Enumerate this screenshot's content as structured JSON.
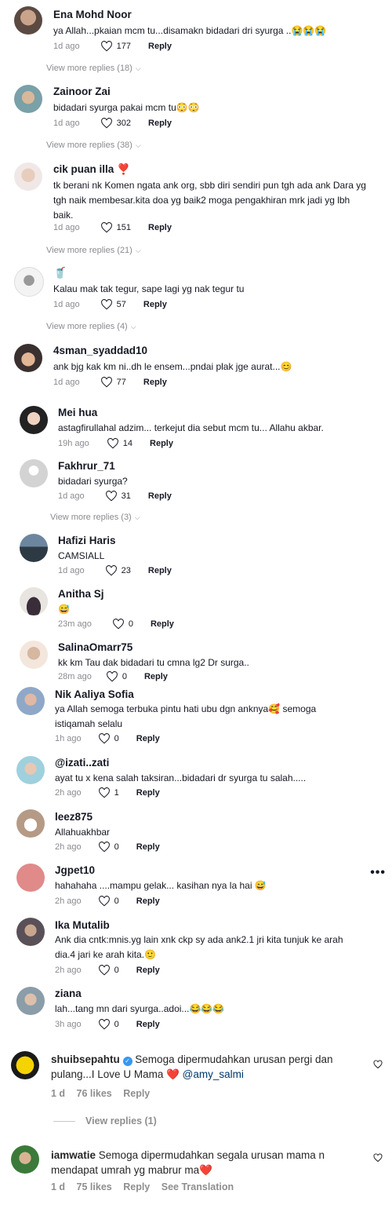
{
  "comments": [
    {
      "name": "Ena Mohd Noor",
      "text": "ya Allah...pkaian mcm tu...disamakn bidadari dri syurga ..",
      "emoji": "😭😭😭",
      "time": "1d ago",
      "likes": "177",
      "reply": "Reply",
      "view_more": "View more replies (18)"
    },
    {
      "name": "Zainoor Zai",
      "text": "bidadari syurga pakai mcm tu",
      "emoji": "😳😳",
      "time": "1d ago",
      "likes": "302",
      "reply": "Reply",
      "view_more": "View more replies (38)"
    },
    {
      "name": "cik puan illa",
      "name_emoji": "❣️",
      "text": "tk berani nk Komen ngata ank org, sbb diri sendiri pun tgh ada ank Dara yg tgh naik membesar.kita doa yg baik2 moga pengakhiran mrk jadi yg lbh baik.",
      "time": "1d ago",
      "likes": "151",
      "reply": "Reply",
      "view_more": "View more replies (21)"
    },
    {
      "name": "🥤",
      "text": "Kalau mak tak tegur, sape lagi yg nak tegur tu",
      "time": "1d ago",
      "likes": "57",
      "reply": "Reply",
      "view_more": "View more replies (4)"
    },
    {
      "name": "4sman_syaddad10",
      "text": "ank bjg kak km ni..dh le ensem...pndai plak jge aurat...",
      "emoji": "😊",
      "time": "1d ago",
      "likes": "77",
      "reply": "Reply"
    }
  ],
  "replies": [
    {
      "name": "Mei hua",
      "text": "astagfirullahal adzim... terkejut dia sebut mcm tu... Allahu akbar.",
      "time": "19h ago",
      "likes": "14",
      "reply": "Reply"
    },
    {
      "name": "Fakhrur_71",
      "text": "bidadari syurga?",
      "time": "1d ago",
      "likes": "31",
      "reply": "Reply",
      "view_more": "View more replies (3)"
    }
  ],
  "comments2": [
    {
      "name": "Hafizi Haris",
      "text": "CAMSIALL",
      "time": "1d ago",
      "likes": "23",
      "reply": "Reply"
    },
    {
      "name": "Anitha Sj",
      "text": "",
      "emoji": "😅",
      "time": "23m ago",
      "likes": "0",
      "reply": "Reply"
    },
    {
      "name": "SalinaOmarr75",
      "text": "kk km Tau dak bidadari tu cmna lg2 Dr surga..",
      "time": "28m ago",
      "likes": "0",
      "reply": "Reply"
    },
    {
      "name": "Nik Aaliya Sofia",
      "text": "ya Allah semoga terbuka pintu hati ubu dgn anknya",
      "emoji": "🥰",
      "text2": " semoga istiqamah selalu",
      "time": "1h ago",
      "likes": "0",
      "reply": "Reply"
    },
    {
      "name": "@izati..zati",
      "text": "ayat tu x kena salah taksiran...bidadari dr syurga tu salah.....",
      "time": "2h ago",
      "likes": "1",
      "reply": "Reply"
    },
    {
      "name": "leez875",
      "text": "Allahuakhbar",
      "time": "2h ago",
      "likes": "0",
      "reply": "Reply"
    },
    {
      "name": "Jgpet10",
      "text": "hahahaha ....mampu gelak... kasihan nya la hai",
      "emoji": "😅",
      "time": "2h ago",
      "likes": "0",
      "reply": "Reply"
    },
    {
      "name": "Ika Mutalib",
      "text": "Ank dia cntk:mnis.yg lain xnk ckp sy ada ank2.1 jri kita tunjuk ke arah dia.4 jari ke arah kita.",
      "emoji": "🙂",
      "time": "2h ago",
      "likes": "0",
      "reply": "Reply"
    },
    {
      "name": "ziana",
      "text": "lah...tang mn dari syurga..adoi...",
      "emoji": "😂😂😂",
      "time": "3h ago",
      "likes": "0",
      "reply": "Reply"
    }
  ],
  "more_icon": "•••",
  "ig": [
    {
      "name": "shuibsepahtu",
      "text": "Semoga dipermudahkan urusan pergi dan pulang...I Love U Mama",
      "heart": "❤️",
      "mention": "@amy_salmi",
      "time": "1 d",
      "likes": "76 likes",
      "reply": "Reply",
      "view_replies": "View replies (1)"
    },
    {
      "name": "iamwatie",
      "text": "Semoga dipermudahkan segala urusan mama n mendapat umrah yg mabrur ma",
      "heart": "❤️",
      "time": "1 d",
      "likes": "75 likes",
      "reply": "Reply",
      "translate": "See Translation"
    }
  ],
  "colors": {
    "text": "#161823",
    "muted": "#8a8b91",
    "ig_muted": "#8e8e8e",
    "mention": "#00376b",
    "verified": "#3897f0"
  }
}
